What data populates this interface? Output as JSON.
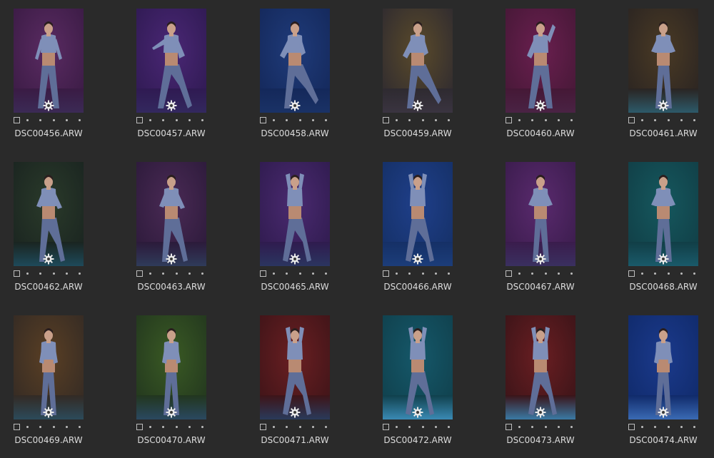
{
  "thumbnails": [
    {
      "filename": "DSC00456.ARW",
      "bg": "#5a2b62",
      "bg2": "#3a1b44",
      "floor": "#3b2a55",
      "pose": "a"
    },
    {
      "filename": "DSC00457.ARW",
      "bg": "#4a2775",
      "bg2": "#2f1a52",
      "floor": "#33285e",
      "pose": "b"
    },
    {
      "filename": "DSC00458.ARW",
      "bg": "#1f3b7a",
      "bg2": "#14285a",
      "floor": "#1a3266",
      "pose": "c"
    },
    {
      "filename": "DSC00459.ARW",
      "bg": "#5a4a2a",
      "bg2": "#2e2a30",
      "floor": "#3a3440",
      "pose": "c"
    },
    {
      "filename": "DSC00460.ARW",
      "bg": "#6a1f4f",
      "bg2": "#451836",
      "floor": "#4a2344",
      "pose": "d"
    },
    {
      "filename": "DSC00461.ARW",
      "bg": "#4a3a24",
      "bg2": "#2a2422",
      "floor": "#2d5a6a",
      "pose": "e"
    },
    {
      "filename": "DSC00462.ARW",
      "bg": "#2a3a2a",
      "bg2": "#1a2420",
      "floor": "#1e4a5a",
      "pose": "f"
    },
    {
      "filename": "DSC00463.ARW",
      "bg": "#4a2a55",
      "bg2": "#2c1a3a",
      "floor": "#2f3b5a",
      "pose": "f"
    },
    {
      "filename": "DSC00465.ARW",
      "bg": "#4a2a70",
      "bg2": "#2f1b4e",
      "floor": "#2b3560",
      "pose": "g"
    },
    {
      "filename": "DSC00466.ARW",
      "bg": "#1f3f8a",
      "bg2": "#153066",
      "floor": "#1c3d7a",
      "pose": "g"
    },
    {
      "filename": "DSC00467.ARW",
      "bg": "#5a2a6e",
      "bg2": "#3a1c4c",
      "floor": "#3a3060",
      "pose": "e"
    },
    {
      "filename": "DSC00468.ARW",
      "bg": "#15585e",
      "bg2": "#113e46",
      "floor": "#1a5a6a",
      "pose": "e"
    },
    {
      "filename": "DSC00469.ARW",
      "bg": "#5a3f24",
      "bg2": "#332a24",
      "floor": "#2c4a5a",
      "pose": "h"
    },
    {
      "filename": "DSC00470.ARW",
      "bg": "#3a5a24",
      "bg2": "#22361e",
      "floor": "#2a4860",
      "pose": "h"
    },
    {
      "filename": "DSC00471.ARW",
      "bg": "#6a1f22",
      "bg2": "#3e1418",
      "floor": "#2a3a5a",
      "pose": "g"
    },
    {
      "filename": "DSC00472.ARW",
      "bg": "#15586a",
      "bg2": "#10404c",
      "floor": "#3a8ab4",
      "pose": "g"
    },
    {
      "filename": "DSC00473.ARW",
      "bg": "#6a1e22",
      "bg2": "#3a1418",
      "floor": "#3a7aa4",
      "pose": "g"
    },
    {
      "filename": "DSC00474.ARW",
      "bg": "#1b3a8c",
      "bg2": "#102a6a",
      "floor": "#3a6ab4",
      "pose": "h"
    }
  ],
  "icons": {
    "settings": "gear-icon",
    "select": "checkbox-icon",
    "rating": "rating-dots-icon"
  },
  "colors": {
    "background": "#2a2a2a",
    "text": "#dcdcdc",
    "suit": "#7f8fb8"
  }
}
